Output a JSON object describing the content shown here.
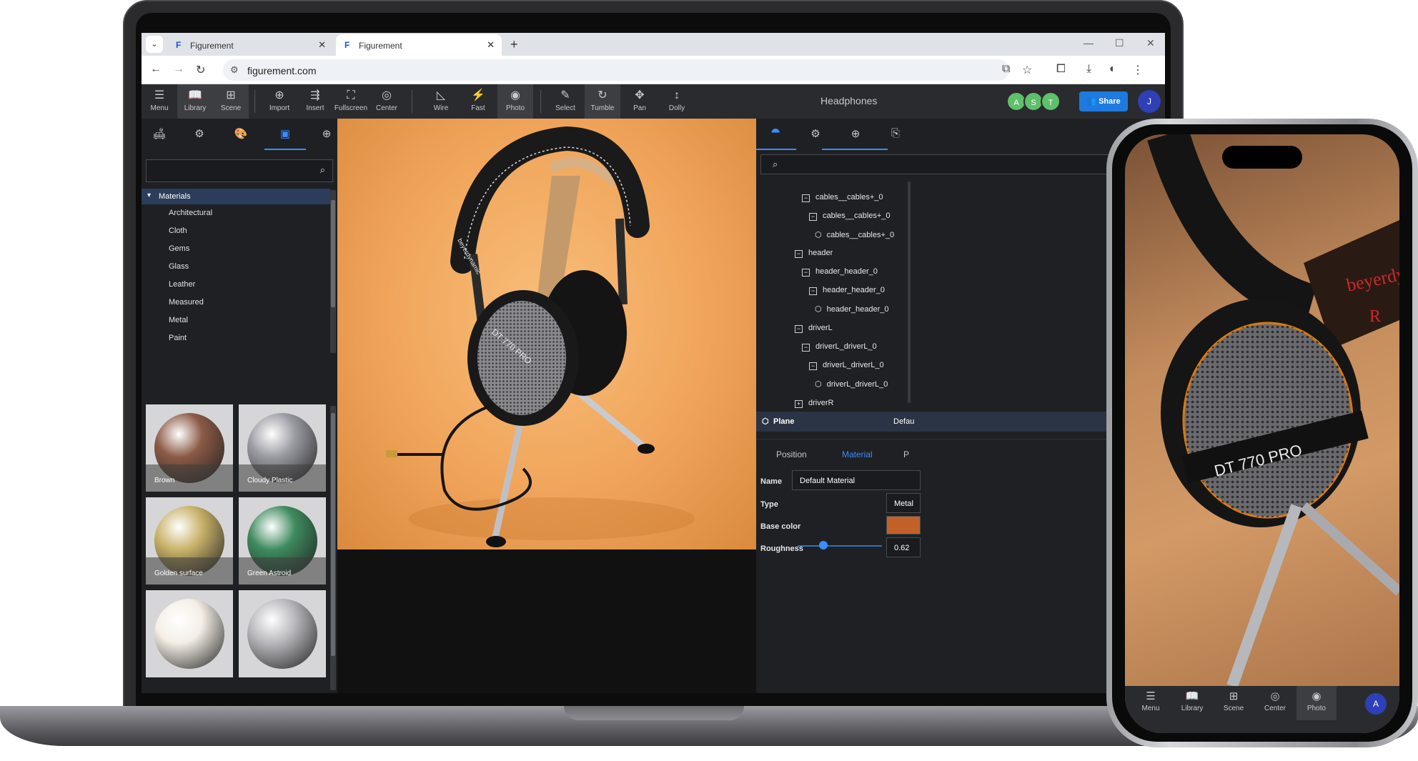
{
  "browser": {
    "tabs": [
      {
        "favicon": "F",
        "title": "Figurement",
        "close": "✕"
      },
      {
        "favicon": "F",
        "title": "Figurement",
        "close": "✕"
      }
    ],
    "new_tab": "+",
    "url": "figurement.com"
  },
  "toolbar": {
    "items": [
      {
        "icon": "menu-icon",
        "label": "Menu",
        "glyph": "☰"
      },
      {
        "icon": "library-icon",
        "label": "Library",
        "glyph": "📖"
      },
      {
        "icon": "scene-icon",
        "label": "Scene",
        "glyph": "⊞"
      },
      {
        "icon": "import-icon",
        "label": "Import",
        "glyph": "⊕"
      },
      {
        "icon": "insert-icon",
        "label": "Insert",
        "glyph": "⇶"
      },
      {
        "icon": "fullscreen-icon",
        "label": "Fullscreen",
        "glyph": "⛶"
      },
      {
        "icon": "center-icon",
        "label": "Center",
        "glyph": "◎"
      },
      {
        "icon": "wire-icon",
        "label": "Wire",
        "glyph": "◺"
      },
      {
        "icon": "fast-icon",
        "label": "Fast",
        "glyph": "⚡"
      },
      {
        "icon": "photo-icon",
        "label": "Photo",
        "glyph": "◉"
      },
      {
        "icon": "select-icon",
        "label": "Select",
        "glyph": "✎"
      },
      {
        "icon": "tumble-icon",
        "label": "Tumble",
        "glyph": "↻"
      },
      {
        "icon": "pan-icon",
        "label": "Pan",
        "glyph": "✥"
      },
      {
        "icon": "dolly-icon",
        "label": "Dolly",
        "glyph": "↕"
      }
    ],
    "doc_title": "Headphones",
    "collaborators": [
      "A",
      "S",
      "T"
    ],
    "share_label": "Share",
    "user_initial": "J"
  },
  "library": {
    "tree_header": "Materials",
    "categories": [
      "Architectural",
      "Cloth",
      "Gems",
      "Glass",
      "Leather",
      "Measured",
      "Metal",
      "Paint"
    ],
    "materials": [
      {
        "name": "Brown",
        "color": "#8b5a46"
      },
      {
        "name": "Cloudy Plastic",
        "color": "#9a9aa2"
      },
      {
        "name": "Golden surface",
        "color": "#c9b26a"
      },
      {
        "name": "Green Astroid",
        "color": "#3e8a5e"
      },
      {
        "name": "",
        "color": "#f4efe6"
      },
      {
        "name": "",
        "color": "#b8b8bc"
      }
    ]
  },
  "scene": {
    "nodes": [
      {
        "label": "cables__cables+_0",
        "type": "group",
        "sym": "−"
      },
      {
        "label": "cables__cables+_0",
        "type": "group",
        "sym": "−"
      },
      {
        "label": "cables__cables+_0",
        "type": "mesh"
      },
      {
        "label": "header",
        "type": "group",
        "sym": "−"
      },
      {
        "label": "header_header_0",
        "type": "group",
        "sym": "−"
      },
      {
        "label": "header_header_0",
        "type": "group",
        "sym": "−"
      },
      {
        "label": "header_header_0",
        "type": "mesh"
      },
      {
        "label": "driverL",
        "type": "group",
        "sym": "−"
      },
      {
        "label": "driverL_driverL_0",
        "type": "group",
        "sym": "−"
      },
      {
        "label": "driverL_driverL_0",
        "type": "group",
        "sym": "−"
      },
      {
        "label": "driverL_driverL_0",
        "type": "mesh"
      },
      {
        "label": "driverR",
        "type": "group",
        "sym": "+"
      }
    ],
    "selected": {
      "label": "Plane",
      "material_short": "Defau"
    }
  },
  "properties": {
    "tabs": [
      "Position",
      "Material",
      "P"
    ],
    "name_label": "Name",
    "name_value": "Default Material",
    "type_label": "Type",
    "type_value": "Metal",
    "base_color_label": "Base color",
    "base_color": "#c2602a",
    "roughness_label": "Roughness",
    "roughness_value": "0.62"
  },
  "phone": {
    "nav": [
      {
        "icon": "menu-icon",
        "label": "Menu",
        "glyph": "☰"
      },
      {
        "icon": "library-icon",
        "label": "Library",
        "glyph": "📖"
      },
      {
        "icon": "scene-icon",
        "label": "Scene",
        "glyph": "⊞"
      },
      {
        "icon": "center-icon",
        "label": "Center",
        "glyph": "◎"
      },
      {
        "icon": "photo-icon",
        "label": "Photo",
        "glyph": "◉"
      }
    ],
    "user_initial": "A",
    "earcup_text": "DT 770 PRO",
    "brand_text": "beyerdy",
    "side_letter": "R"
  },
  "viewport": {
    "earcup_text": "DT 770 PRO",
    "brand_text": "beyerdynamic"
  }
}
